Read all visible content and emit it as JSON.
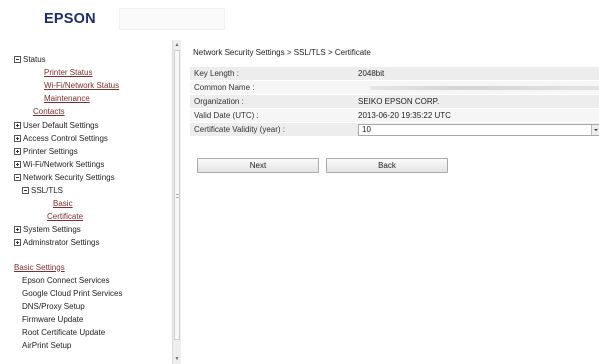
{
  "header": {
    "logo": "EPSON"
  },
  "sidebar": {
    "items": [
      {
        "label": "Status",
        "kind": "toggle",
        "toggle": "minus",
        "indent": 0
      },
      {
        "label": "Printer Status",
        "kind": "link",
        "indent": 30
      },
      {
        "label": "Wi-Fi/Network Status",
        "kind": "link",
        "indent": 30
      },
      {
        "label": "Maintenance",
        "kind": "link",
        "indent": 30
      },
      {
        "label": "Contacts",
        "kind": "link",
        "indent": 19
      },
      {
        "label": "User Default Settings",
        "kind": "toggle",
        "toggle": "plus",
        "indent": 0
      },
      {
        "label": "Access Control Settings",
        "kind": "toggle",
        "toggle": "plus",
        "indent": 0
      },
      {
        "label": "Printer Settings",
        "kind": "toggle",
        "toggle": "plus",
        "indent": 0
      },
      {
        "label": "Wi-Fi/Network Settings",
        "kind": "toggle",
        "toggle": "plus",
        "indent": 0
      },
      {
        "label": "Network Security Settings",
        "kind": "toggle",
        "toggle": "minus",
        "indent": 0
      },
      {
        "label": "SSL/TLS",
        "kind": "toggle",
        "toggle": "minus",
        "indent": 8
      },
      {
        "label": "Basic",
        "kind": "link",
        "indent": 39
      },
      {
        "label": "Certificate",
        "kind": "link",
        "indent": 33
      },
      {
        "label": "System Settings",
        "kind": "toggle",
        "toggle": "plus",
        "indent": 0
      },
      {
        "label": "Adminstrator Settings",
        "kind": "toggle",
        "toggle": "plus",
        "indent": 0
      },
      {
        "label": "",
        "kind": "spacer",
        "indent": 0
      },
      {
        "label": "Basic Settings",
        "kind": "link",
        "indent": 0
      },
      {
        "label": "Epson Connect Services",
        "kind": "text",
        "indent": 8
      },
      {
        "label": "Google Cloud Print Services",
        "kind": "text",
        "indent": 8
      },
      {
        "label": "DNS/Proxy Setup",
        "kind": "text",
        "indent": 8
      },
      {
        "label": "Firmware Update",
        "kind": "text",
        "indent": 8
      },
      {
        "label": "Root Certificate Update",
        "kind": "text",
        "indent": 8
      },
      {
        "label": "AirPrint Setup",
        "kind": "text",
        "indent": 8
      }
    ]
  },
  "main": {
    "breadcrumb": "Network Security Settings > SSL/TLS > Certificate",
    "rows": [
      {
        "label": "Key Length :",
        "value": "2048bit"
      },
      {
        "label": "Common Name :",
        "value": ""
      },
      {
        "label": "Organization :",
        "value": "SEIKO EPSON CORP."
      },
      {
        "label": "Valid Date (UTC) :",
        "value": "2013-06-20 19:35:22 UTC"
      },
      {
        "label": "Certificate Validity (year) :",
        "value": "10"
      }
    ],
    "next_label": "Next",
    "back_label": "Back"
  },
  "colors": {
    "logo": "#1c2c73",
    "link": "#7e2d2d"
  }
}
